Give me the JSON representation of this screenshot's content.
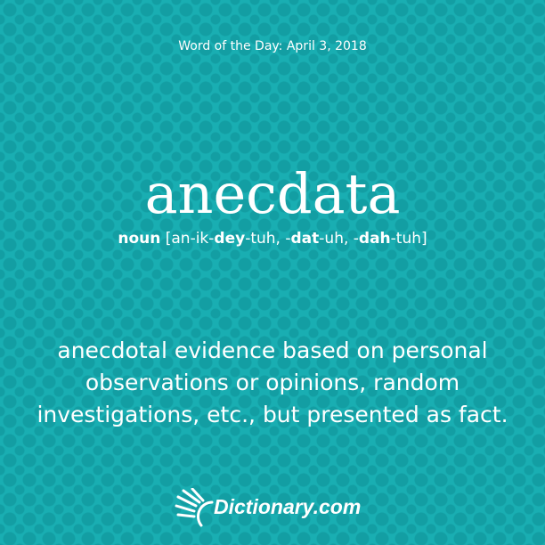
{
  "header": {
    "date_label": "Word of the Day: April 3, 2018"
  },
  "entry": {
    "word": "anecdata",
    "part_of_speech": "noun",
    "pronunciation": [
      {
        "text": " [an-ik-",
        "bold": false
      },
      {
        "text": "dey",
        "bold": true
      },
      {
        "text": "-tuh, -",
        "bold": false
      },
      {
        "text": "dat",
        "bold": true
      },
      {
        "text": "-uh, -",
        "bold": false
      },
      {
        "text": "dah",
        "bold": true
      },
      {
        "text": "-tuh]",
        "bold": false
      }
    ],
    "definition": "anecdotal evidence based on personal observations or opinions, random investigations, etc., but presented as fact."
  },
  "brand": {
    "logo_text": "Dictionary.com"
  },
  "colors": {
    "background": "#19aeb2",
    "dots": "#139ea3",
    "text": "#ffffff"
  }
}
